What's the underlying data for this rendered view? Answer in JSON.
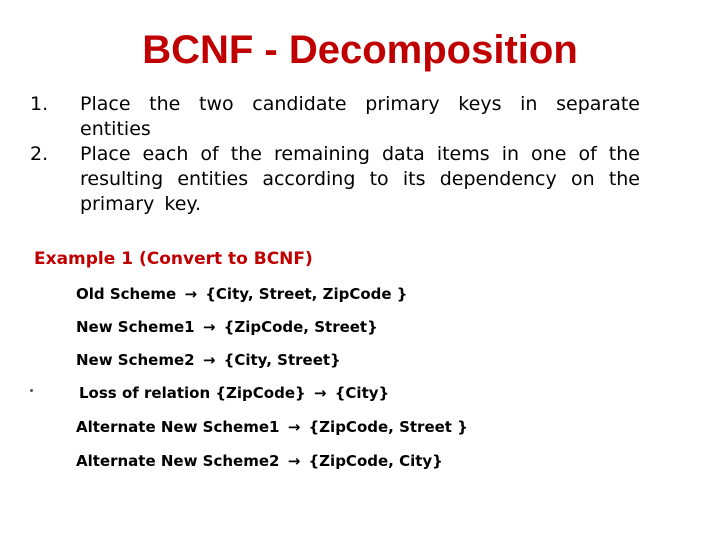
{
  "slide": {
    "title": "BCNF - Decomposition",
    "title_color": "#c00000",
    "numbered_items": [
      {
        "number": "1.",
        "text": "Place the two candidate primary keys in separate entities"
      },
      {
        "number": "2.",
        "text": "Place each of the remaining data items in one of the resulting entities according to its dependency on the primary key."
      }
    ],
    "example": {
      "heading": "Example 1 (Convert to BCNF)",
      "heading_color": "#c00000",
      "arrow_icon": "right-arrow-icon",
      "arrow_glyph": "→",
      "lines": [
        {
          "left": "Old Scheme",
          "right": "{City, Street, ZipCode }"
        },
        {
          "left": "New Scheme1",
          "right": "{ZipCode, Street}"
        },
        {
          "left": "New Scheme2",
          "right": "{City, Street}"
        },
        {
          "left": "Loss of relation {ZipCode}",
          "right": "{City}",
          "bulleted": true
        },
        {
          "left": "Alternate New Scheme1",
          "right": "{ZipCode, Street }"
        },
        {
          "left": "Alternate New Scheme2",
          "right": "{ZipCode, City}"
        }
      ]
    }
  }
}
